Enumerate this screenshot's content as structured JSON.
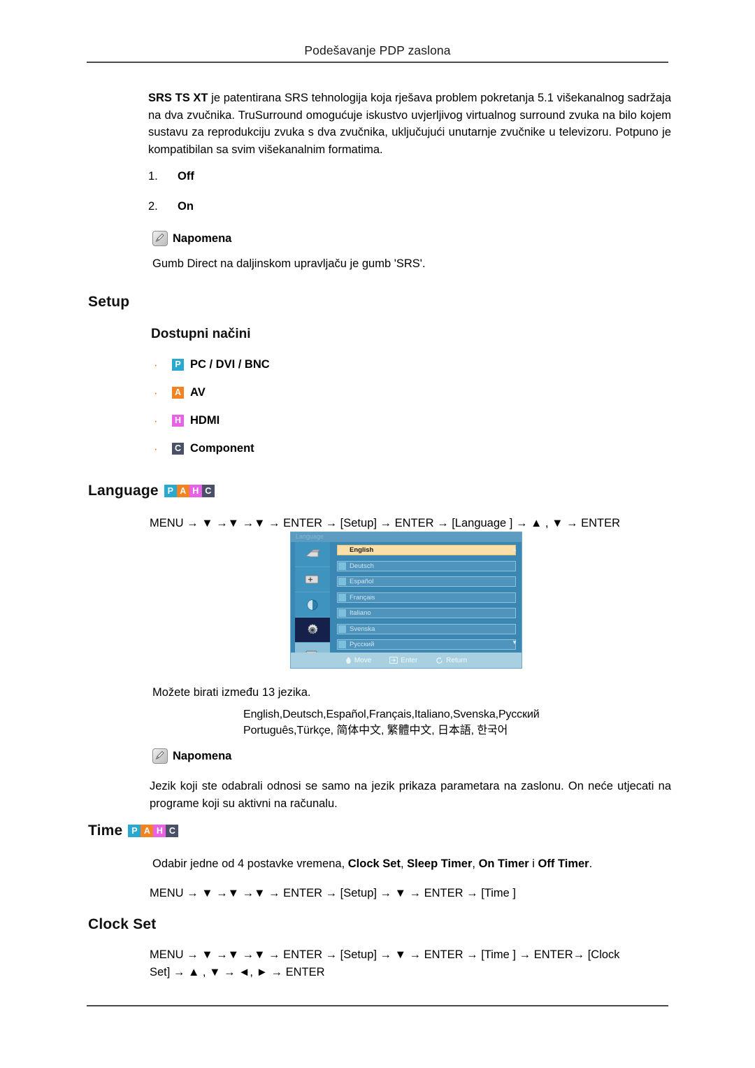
{
  "header": {
    "title": "Podešavanje PDP zaslona"
  },
  "srs": {
    "intro_bold": "SRS TS XT",
    "intro_rest": " je patentirana SRS tehnologija koja rješava problem pokretanja 5.1 višekanalnog sadržaja na dva zvučnika. TruSurround omogućuje iskustvo uvjerljivog virtualnog surround zvuka na bilo kojem sustavu za reprodukciju zvuka s dva zvučnika, uključujući unutarnje zvučnike u televizoru. Potpuno je kompatibilan sa svim višekanalnim formatima.",
    "options": [
      {
        "num": "1.",
        "label": "Off"
      },
      {
        "num": "2.",
        "label": "On"
      }
    ],
    "note_label": "Napomena",
    "note_text": "Gumb Direct na daljinskom upravljaču je gumb 'SRS'."
  },
  "setup": {
    "heading": "Setup",
    "subheading": "Dostupni načini",
    "modes": [
      {
        "badge": "P",
        "color": "#29a8d0",
        "label": "PC / DVI / BNC"
      },
      {
        "badge": "A",
        "color": "#f58220",
        "label": "AV"
      },
      {
        "badge": "H",
        "color": "#e862e8",
        "label": "HDMI"
      },
      {
        "badge": "C",
        "color": "#4a5068",
        "label": "Component"
      }
    ]
  },
  "badges_strip": [
    {
      "badge": "P",
      "color": "#29a8d0"
    },
    {
      "badge": "A",
      "color": "#f58220"
    },
    {
      "badge": "H",
      "color": "#e862e8"
    },
    {
      "badge": "C",
      "color": "#4a5068"
    }
  ],
  "language": {
    "heading": "Language",
    "menu_path": "MENU → ▼ →▼ →▼ → ENTER → [Setup] → ENTER → [Language ] → ▲ , ▼ → ENTER",
    "osd": {
      "title": "Language",
      "items": [
        {
          "label": "English",
          "active": true
        },
        {
          "label": "Deutsch",
          "active": false
        },
        {
          "label": "Español",
          "active": false
        },
        {
          "label": "Français",
          "active": false
        },
        {
          "label": "Italiano",
          "active": false
        },
        {
          "label": "Svenska",
          "active": false
        },
        {
          "label": "Русский",
          "active": false
        }
      ],
      "footer": [
        {
          "icon": "dpad-icon",
          "label": "Move"
        },
        {
          "icon": "enter-icon",
          "label": "Enter"
        },
        {
          "icon": "return-icon",
          "label": "Return"
        }
      ],
      "scroll_up": "▲",
      "scroll_down": "▼"
    },
    "count_text": "Možete birati između 13 jezika.",
    "list_line1": "English,Deutsch,Español,Français,Italiano,Svenska,Русский",
    "list_line2": "Português,Türkçe, 简体中文,  繁體中文, 日本語, 한국어",
    "note_label": "Napomena",
    "note_text": "Jezik koji ste odabrali odnosi se samo na jezik prikaza parametara na zaslonu. On neće utjecati na programe koji su aktivni na računalu."
  },
  "time": {
    "heading": "Time",
    "desc_pre": "Odabir jedne od 4 postavke vremena, ",
    "desc_b1": "Clock Set",
    "desc_sep1": ", ",
    "desc_b2": "Sleep Timer",
    "desc_sep2": ", ",
    "desc_b3": "On Timer",
    "desc_sep3": " i ",
    "desc_b4": "Off Timer",
    "desc_end": ".",
    "menu_path": "MENU → ▼ →▼ →▼ → ENTER → [Setup] → ▼ → ENTER → [Time ]"
  },
  "clock_set": {
    "heading": "Clock Set",
    "menu_path_line1": "MENU → ▼ →▼ →▼ → ENTER → [Setup] → ▼ → ENTER → [Time ] → ENTER→ [Clock",
    "menu_path_line2": "Set] → ▲ , ▼ → ◄, ► → ENTER"
  }
}
